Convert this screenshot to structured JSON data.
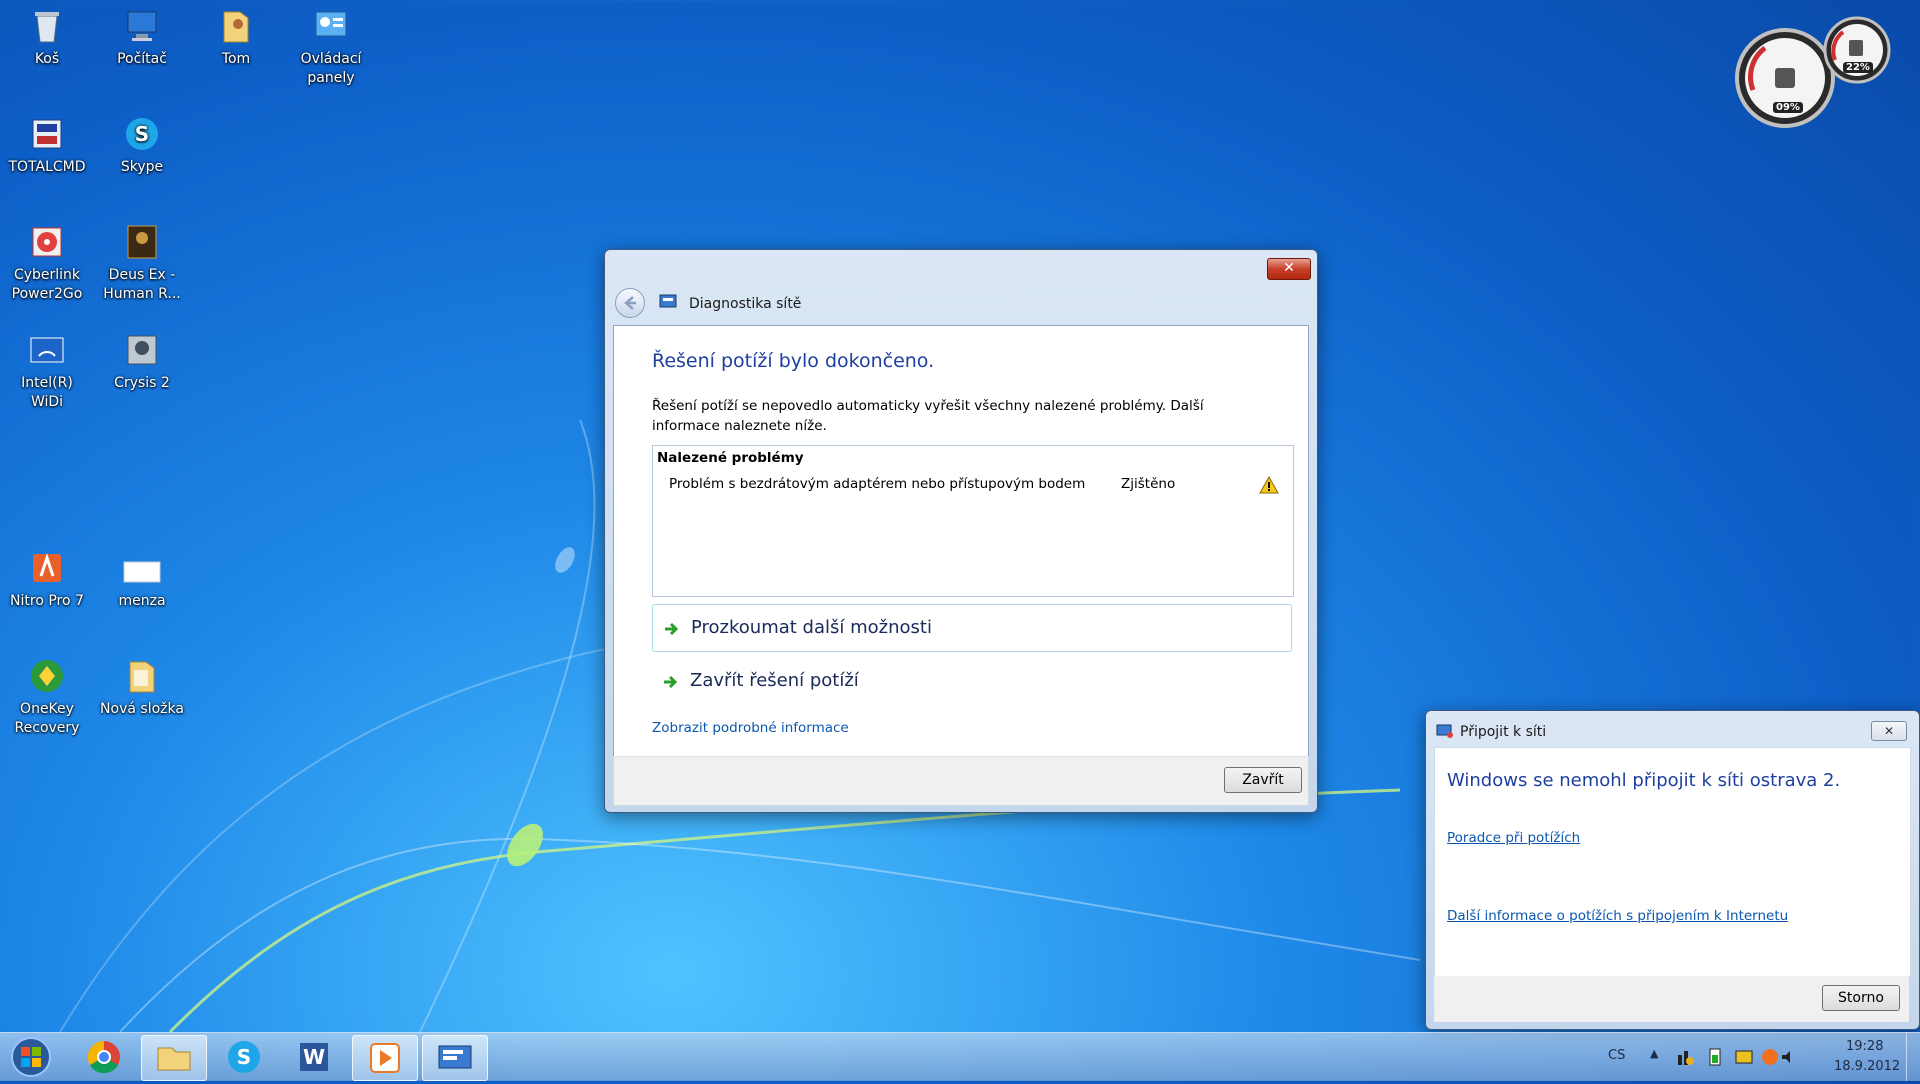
{
  "desktop": {
    "icons": [
      {
        "label": "Koš",
        "icon": "recycle-bin-icon"
      },
      {
        "label": "Počítač",
        "icon": "computer-icon"
      },
      {
        "label": "Tom",
        "icon": "user-folder-icon"
      },
      {
        "label": "Ovládací panely",
        "icon": "control-panel-icon"
      },
      {
        "label": "TOTALCMD",
        "icon": "total-commander-icon"
      },
      {
        "label": "Skype",
        "icon": "skype-icon"
      },
      {
        "label": "Cyberlink Power2Go",
        "icon": "power2go-icon"
      },
      {
        "label": "Deus Ex - Human R...",
        "icon": "deus-ex-icon"
      },
      {
        "label": "Intel(R) WiDi",
        "icon": "widi-icon"
      },
      {
        "label": "Crysis 2",
        "icon": "crysis-icon"
      },
      {
        "label": "Nitro Pro 7",
        "icon": "nitro-pdf-icon"
      },
      {
        "label": "menza",
        "icon": "document-icon"
      },
      {
        "label": "OneKey Recovery",
        "icon": "onekey-recovery-icon"
      },
      {
        "label": "Nová složka",
        "icon": "folder-icon"
      }
    ]
  },
  "gadget": {
    "cpu_percent": "09%",
    "memory_percent": "22%"
  },
  "diagnostics_window": {
    "title": "Diagnostika sítě",
    "heading": "Řešení potíží bylo dokončeno.",
    "description": "Řešení potíží se nepovedlo automaticky vyřešit všechny nalezené problémy. Další informace naleznete níže.",
    "problems_header": "Nalezené problémy",
    "problems": [
      {
        "name": "Problém s bezdrátovým adaptérem nebo přístupovým bodem",
        "status": "Zjištěno"
      }
    ],
    "option_explore": "Prozkoumat další možnosti",
    "option_close": "Zavřít řešení potíží",
    "details_link": "Zobrazit podrobné informace",
    "close_button": "Zavřít",
    "close_x": "✕"
  },
  "connect_window": {
    "title": "Připojit k síti",
    "message": "Windows se nemohl připojit k síti ostrava 2.",
    "link_troubleshoot": "Poradce při potížích",
    "link_more_info": "Další informace o potížích s připojením k Internetu",
    "cancel_button": "Storno",
    "close_x": "✕"
  },
  "taskbar": {
    "apps": [
      {
        "name": "chrome"
      },
      {
        "name": "explorer"
      },
      {
        "name": "skype"
      },
      {
        "name": "word"
      },
      {
        "name": "media-player"
      },
      {
        "name": "network-diagnostics"
      }
    ],
    "language": "CS",
    "time": "19:28",
    "date": "18.9.2012"
  }
}
